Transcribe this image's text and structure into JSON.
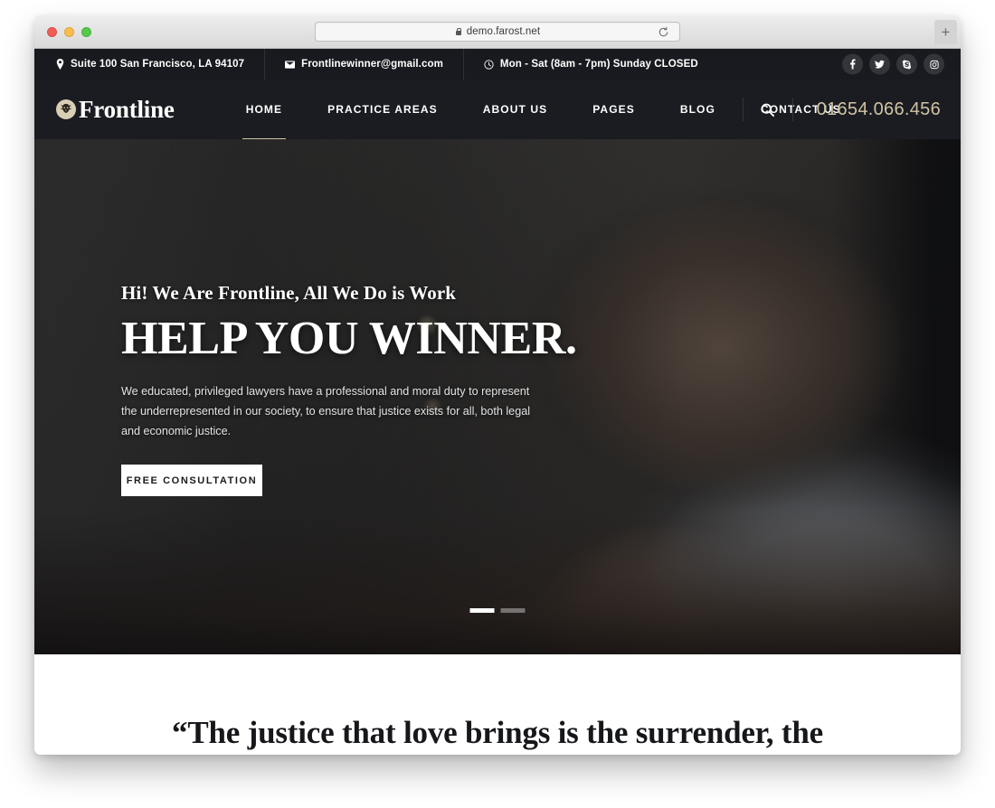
{
  "browser": {
    "url": "demo.farost.net",
    "lock_icon": "lock-icon",
    "reload_icon": "reload-icon",
    "newtab_label": "+",
    "traffic_lights": [
      "close",
      "minimize",
      "maximize"
    ]
  },
  "topbar": {
    "items": [
      {
        "icon": "map-pin-icon",
        "text": "Suite 100 San Francisco, LA 94107"
      },
      {
        "icon": "envelope-icon",
        "text": "Frontlinewinner@gmail.com"
      },
      {
        "icon": "clock-icon",
        "text": "Mon - Sat (8am - 7pm) Sunday CLOSED"
      }
    ],
    "social": [
      {
        "icon": "facebook-icon",
        "glyph": "f"
      },
      {
        "icon": "twitter-icon",
        "glyph": "t"
      },
      {
        "icon": "skype-icon",
        "glyph": "S"
      },
      {
        "icon": "instagram-icon",
        "glyph": "i"
      }
    ]
  },
  "nav": {
    "brand": "Frontline",
    "brand_emblem": "lion-emblem-icon",
    "links": [
      {
        "label": "HOME",
        "active": true
      },
      {
        "label": "PRACTICE AREAS",
        "active": false
      },
      {
        "label": "ABOUT US",
        "active": false
      },
      {
        "label": "PAGES",
        "active": false
      },
      {
        "label": "BLOG",
        "active": false
      },
      {
        "label": "CONTACT US",
        "active": false
      }
    ],
    "search_icon": "search-icon",
    "phone": "01654.066.456"
  },
  "hero": {
    "eyebrow": "Hi! We Are Frontline, All We Do is Work",
    "title": "HELP YOU WINNER.",
    "description": "We educated, privileged lawyers have a professional and moral duty to represent the underrepresented in our society, to ensure that justice exists for all, both legal and economic justice.",
    "cta_label": "FREE CONSULTATION",
    "slides": [
      {
        "active": true
      },
      {
        "active": false
      }
    ]
  },
  "quote": {
    "text": "“The justice that love brings is the surrender, the"
  },
  "colors": {
    "topbar_bg": "#191a1f",
    "nav_bg": "#1b1c21",
    "accent_tan": "#cfc3a4",
    "cta_bg": "#ffffff",
    "text_light": "#ffffff"
  }
}
